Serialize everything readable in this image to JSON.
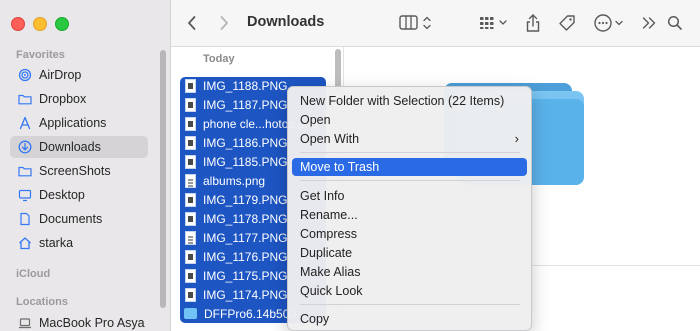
{
  "window": {
    "title": "Downloads"
  },
  "sidebar": {
    "favorites_heading": "Favorites",
    "items": [
      {
        "label": "AirDrop",
        "icon": "airdrop-icon"
      },
      {
        "label": "Dropbox",
        "icon": "folder-icon"
      },
      {
        "label": "Applications",
        "icon": "applications-icon"
      },
      {
        "label": "Downloads",
        "icon": "downloads-icon",
        "active": true
      },
      {
        "label": "ScreenShots",
        "icon": "folder-icon"
      },
      {
        "label": "Desktop",
        "icon": "desktop-icon"
      },
      {
        "label": "Documents",
        "icon": "document-icon"
      },
      {
        "label": "starka",
        "icon": "home-icon"
      }
    ],
    "icloud_heading": "iCloud",
    "locations_heading": "Locations",
    "locations": [
      {
        "label": "MacBook Pro Asya",
        "icon": "laptop-icon"
      }
    ]
  },
  "file_list": {
    "group_heading": "Today",
    "files": [
      {
        "name": "IMG_1188.PNG",
        "kind": "image"
      },
      {
        "name": "IMG_1187.PNG",
        "kind": "image"
      },
      {
        "name": "phone cle...hotos.png",
        "kind": "image"
      },
      {
        "name": "IMG_1186.PNG",
        "kind": "image"
      },
      {
        "name": "IMG_1185.PNG",
        "kind": "image"
      },
      {
        "name": "albums.png",
        "kind": "document"
      },
      {
        "name": "IMG_1179.PNG",
        "kind": "image"
      },
      {
        "name": "IMG_1178.PNG",
        "kind": "image"
      },
      {
        "name": "IMG_1177.PNG",
        "kind": "document"
      },
      {
        "name": "IMG_1176.PNG",
        "kind": "image"
      },
      {
        "name": "IMG_1175.PNG",
        "kind": "image"
      },
      {
        "name": "IMG_1174.PNG",
        "kind": "image"
      },
      {
        "name": "DFFPro6.14b500",
        "kind": "folder"
      }
    ]
  },
  "context_menu": {
    "items": [
      {
        "label": "New Folder with Selection (22 Items)"
      },
      {
        "label": "Open"
      },
      {
        "label": "Open With",
        "submenu": true
      },
      {
        "label": "Move to Trash",
        "highlighted": true
      },
      {
        "label": "Get Info"
      },
      {
        "label": "Rename..."
      },
      {
        "label": "Compress"
      },
      {
        "label": "Duplicate"
      },
      {
        "label": "Make Alias"
      },
      {
        "label": "Quick Look"
      },
      {
        "label": "Copy"
      }
    ]
  },
  "colors": {
    "accent": "#2a6be5",
    "selection": "#1d55c3",
    "sidebar_icon": "#3478f6",
    "folder_preview": "#5fb4ec"
  }
}
